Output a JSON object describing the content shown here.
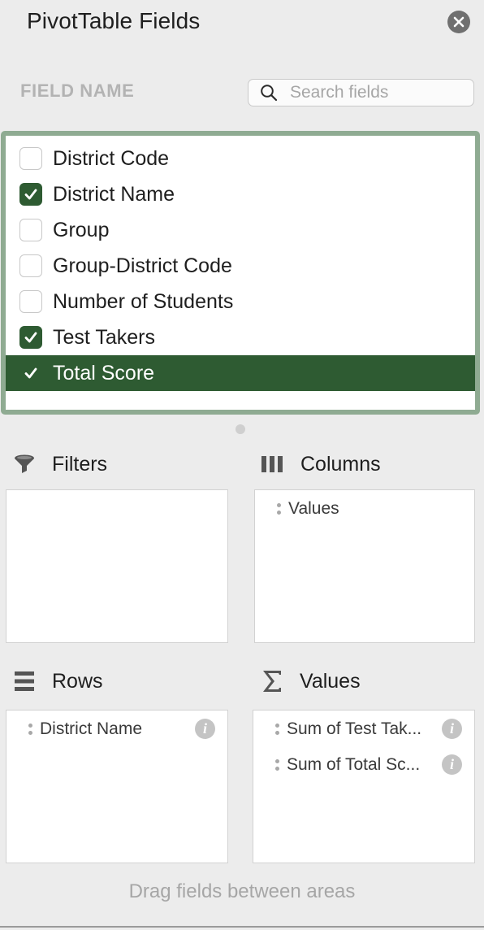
{
  "panel": {
    "title": "PivotTable Fields",
    "close_icon": "close-icon"
  },
  "field_list": {
    "header": "FIELD NAME",
    "search_placeholder": "Search fields",
    "items": [
      {
        "label": "District Code",
        "checked": false,
        "selected": false
      },
      {
        "label": "District Name",
        "checked": true,
        "selected": false
      },
      {
        "label": "Group",
        "checked": false,
        "selected": false
      },
      {
        "label": "Group-District Code",
        "checked": false,
        "selected": false
      },
      {
        "label": "Number of Students",
        "checked": false,
        "selected": false
      },
      {
        "label": "Test Takers",
        "checked": true,
        "selected": false
      },
      {
        "label": "Total Score",
        "checked": true,
        "selected": true
      }
    ]
  },
  "areas": {
    "filters": {
      "label": "Filters",
      "icon": "funnel-icon",
      "items": []
    },
    "columns": {
      "label": "Columns",
      "icon": "columns-icon",
      "items": [
        "Values"
      ]
    },
    "rows": {
      "label": "Rows",
      "icon": "rows-icon",
      "items": [
        "District Name"
      ]
    },
    "values": {
      "label": "Values",
      "icon": "sigma-icon",
      "items": [
        "Sum of Test Tak...",
        "Sum of Total Sc..."
      ]
    }
  },
  "footer": {
    "hint": "Drag fields between areas"
  },
  "colors": {
    "accent_green": "#2e5b32",
    "list_border": "#8fab92",
    "background": "#ececec"
  }
}
